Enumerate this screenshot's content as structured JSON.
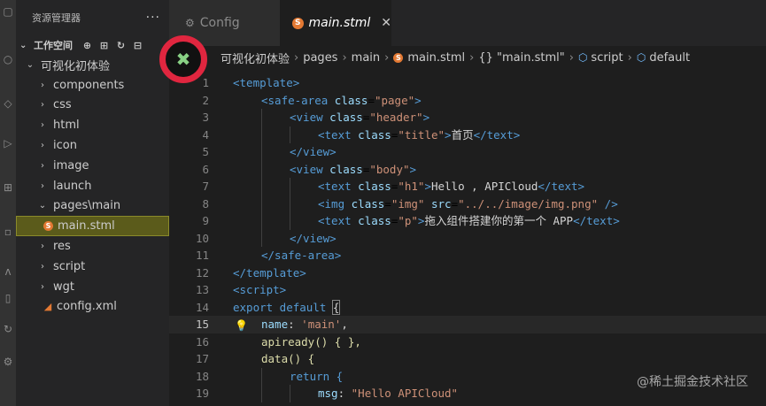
{
  "sidebar": {
    "title": "资源管理器",
    "more": "···",
    "workspace": "工作空间",
    "project": "可视化初体验",
    "items": [
      {
        "label": "components",
        "type": "folder"
      },
      {
        "label": "css",
        "type": "folder"
      },
      {
        "label": "html",
        "type": "folder"
      },
      {
        "label": "icon",
        "type": "folder"
      },
      {
        "label": "image",
        "type": "folder"
      },
      {
        "label": "launch",
        "type": "folder"
      },
      {
        "label": "pages\\main",
        "type": "folder-open"
      },
      {
        "label": "main.stml",
        "type": "file-stml"
      },
      {
        "label": "res",
        "type": "folder"
      },
      {
        "label": "script",
        "type": "folder"
      },
      {
        "label": "wgt",
        "type": "folder"
      },
      {
        "label": "config.xml",
        "type": "file-rss"
      }
    ]
  },
  "tabs": [
    {
      "label": "Config",
      "active": false
    },
    {
      "label": "main.stml",
      "active": true,
      "icon": "S"
    }
  ],
  "breadcrumb": [
    "可视化初体验",
    "pages",
    "main",
    "main.stml",
    "{} \"main.stml\"",
    "script",
    "default"
  ],
  "editor": {
    "lines": [
      {
        "n": "1"
      },
      {
        "n": "2"
      },
      {
        "n": "3"
      },
      {
        "n": "4"
      },
      {
        "n": "5"
      },
      {
        "n": "6"
      },
      {
        "n": "7"
      },
      {
        "n": "8"
      },
      {
        "n": "9"
      },
      {
        "n": "10"
      },
      {
        "n": "11"
      },
      {
        "n": "12"
      },
      {
        "n": "13"
      },
      {
        "n": "14"
      },
      {
        "n": "15"
      },
      {
        "n": "16"
      },
      {
        "n": "17"
      },
      {
        "n": "18"
      },
      {
        "n": "19"
      }
    ],
    "current_line": "15",
    "code": {
      "l1": "<template>",
      "l2_tag": "<safe-area",
      "l2_attr": "class",
      "l2_val": "\"page\"",
      "l3_tag": "<view",
      "l3_attr": "class",
      "l3_val": "\"header\"",
      "l4_tag": "<text",
      "l4_attr": "class",
      "l4_val": "\"title\"",
      "l4_text": "首页",
      "l4_close": "</text>",
      "l5": "</view>",
      "l6_tag": "<view",
      "l6_attr": "class",
      "l6_val": "\"body\"",
      "l7_tag": "<text",
      "l7_attr": "class",
      "l7_val": "\"h1\"",
      "l7_text": "Hello , APICloud",
      "l7_close": "</text>",
      "l8_tag": "<img",
      "l8_attr": "class",
      "l8_val": "\"img\"",
      "l8_attr2": "src",
      "l8_val2": "\"../../image/img.png\"",
      "l8_end": "/>",
      "l9_tag": "<text",
      "l9_attr": "class",
      "l9_val": "\"p\"",
      "l9_text": "拖入组件搭建你的第一个 APP",
      "l9_close": "</text>",
      "l10": "</view>",
      "l11": "</safe-area>",
      "l12": "</template>",
      "l13": "<script>",
      "l14_kw": "export default",
      "l14_brace": "{",
      "l15_prop": "name",
      "l15_val": "'main'",
      "l16": "apiready() { },",
      "l17": "data() {",
      "l18": "return {",
      "l19_prop": "msg",
      "l19_val": "\"Hello APICloud\""
    }
  },
  "watermark": "@稀土掘金技术社区",
  "colors": {
    "accent_orange": "#e37933",
    "selection": "#5b5b1b",
    "annotation_ring": "#e0263f"
  }
}
